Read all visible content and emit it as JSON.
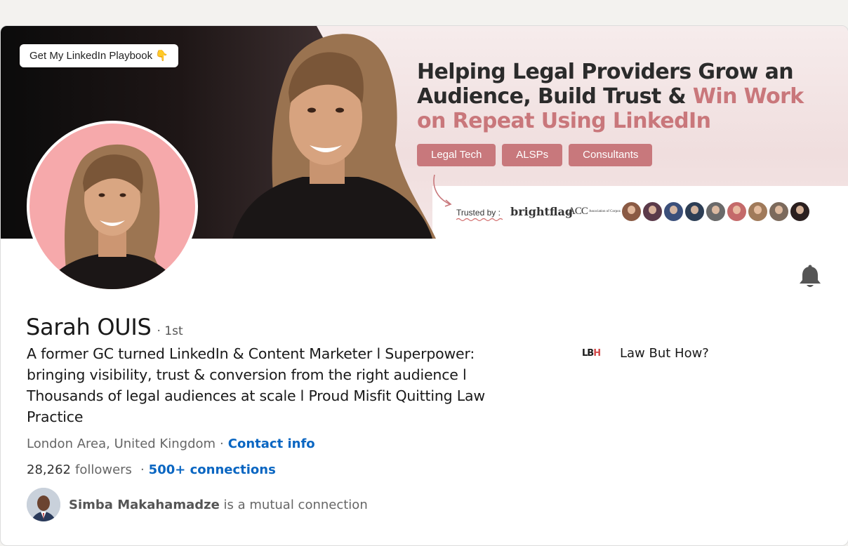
{
  "banner": {
    "cta_label": "Get My LinkedIn Playbook 👇",
    "headline_line1": "Helping Legal Providers Grow an",
    "headline_line2_dark": "Audience, Build Trust & ",
    "headline_line2_accent": "Win Work",
    "headline_line3_accent": "on Repeat Using LinkedIn",
    "tags": [
      "Legal Tech",
      "ALSPs",
      "Consultants"
    ],
    "trusted_label": "Trusted by :",
    "logo_brightflag": "brightflag",
    "logo_acc": "ACC",
    "logo_acc_sub": "Association of Corporate Counsel",
    "accent_color": "#c9777b",
    "avatar_colors": [
      "#8a5a44",
      "#5b3a4a",
      "#3b4f7a",
      "#2d3e55",
      "#6a6a6a",
      "#c46a6a",
      "#a07a5a",
      "#7c6a5c",
      "#2a1f1f"
    ]
  },
  "profile": {
    "name": "Sarah OUIS",
    "degree": "· 1st",
    "headline": "A former GC turned LinkedIn & Content Marketer l Superpower: bringing visibility, trust & conversion from the right audience l Thousands of legal audiences at scale l Proud Misfit Quitting Law Practice",
    "location": "London Area, United Kingdom",
    "separator": "·",
    "contact_info_label": "Contact info",
    "followers_count": "28,262",
    "followers_label": "followers",
    "connections_label": "500+ connections",
    "mutual_name": "Simba Makahamadze",
    "mutual_suffix": "is a mutual connection"
  },
  "company": {
    "logo_text_main": "LB",
    "logo_text_accent": "H",
    "name": "Law But How?"
  }
}
